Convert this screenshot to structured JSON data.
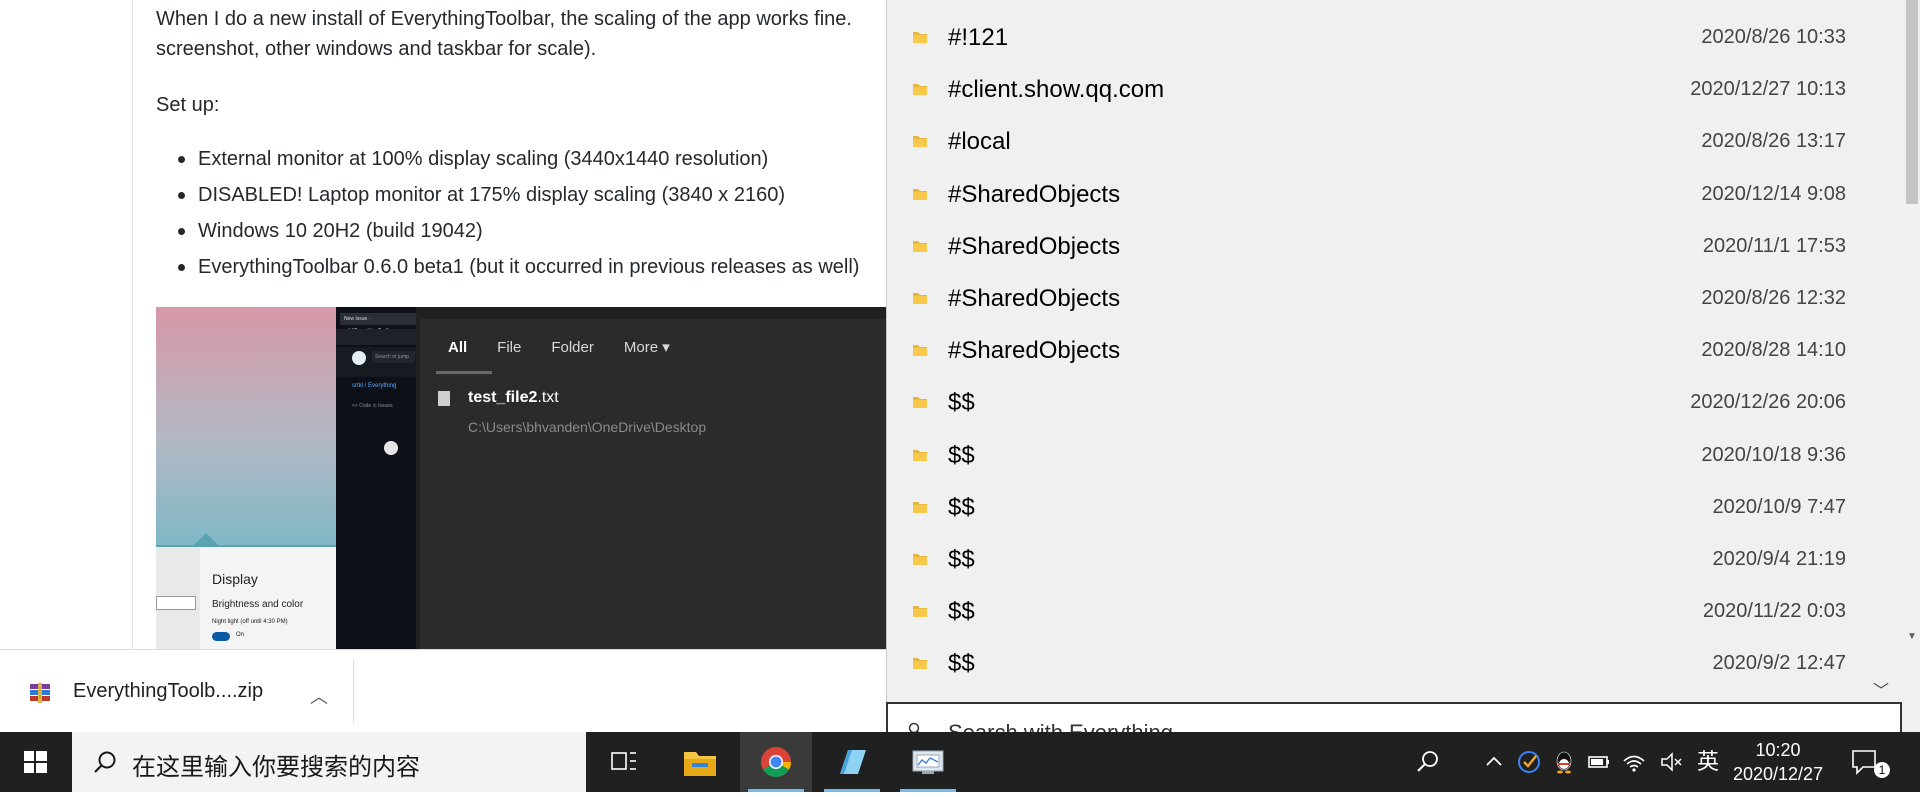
{
  "article": {
    "intro": "When I do a new install of EverythingToolbar, the scaling of the app works fine.",
    "intro_cont": "screenshot, other windows and taskbar for scale).",
    "setup_label": "Set up:",
    "bullets": [
      "External monitor at 100% display scaling (3440x1440 resolution)",
      "DISABLED! Laptop monitor at 175% display scaling (3840 x 2160)",
      "Windows 10 20H2 (build 19042)",
      "EverythingToolbar 0.6.0 beta1 (but it occurred in previous releases as well)"
    ]
  },
  "embedded_screenshot": {
    "settings_title": "Display",
    "settings_subtitle": "Brightness and color",
    "night_light": "Night light (off until 4:30 PM)",
    "toggle_label": "On",
    "browser_tab": "New Issue · srtkl/EverythingToolbar",
    "browser_search": "Search or jump",
    "browser_crumb": "srtkl / Everything",
    "browser_tabs": "<> Code   ⊙ Issues",
    "tabs": [
      "All",
      "File",
      "Folder",
      "More"
    ],
    "result_name_bold": "test_file2",
    "result_name_ext": ".txt",
    "result_path": "C:\\Users\\bhvanden\\OneDrive\\Desktop"
  },
  "download": {
    "filename": "EverythingToolb....zip"
  },
  "results": [
    {
      "name": "#!121",
      "date": "2020/8/26 10:33"
    },
    {
      "name": "#client.show.qq.com",
      "date": "2020/12/27 10:13"
    },
    {
      "name": "#local",
      "date": "2020/8/26 13:17"
    },
    {
      "name": "#SharedObjects",
      "date": "2020/12/14 9:08"
    },
    {
      "name": "#SharedObjects",
      "date": "2020/11/1 17:53"
    },
    {
      "name": "#SharedObjects",
      "date": "2020/8/26 12:32"
    },
    {
      "name": "#SharedObjects",
      "date": "2020/8/28 14:10"
    },
    {
      "name": "$$",
      "date": "2020/12/26 20:06"
    },
    {
      "name": "$$",
      "date": "2020/10/18 9:36"
    },
    {
      "name": "$$",
      "date": "2020/10/9 7:47"
    },
    {
      "name": "$$",
      "date": "2020/9/4 21:19"
    },
    {
      "name": "$$",
      "date": "2020/11/22 0:03"
    },
    {
      "name": "$$",
      "date": "2020/9/2 12:47"
    }
  ],
  "search": {
    "placeholder": "Search with Everything"
  },
  "taskbar": {
    "search_placeholder": "在这里输入你要搜索的内容",
    "ime": "英",
    "time": "10:20",
    "date": "2020/12/27",
    "notification_count": "1"
  },
  "colors": {
    "folder": "#f8c84a",
    "taskbar": "#202020",
    "panel": "#f0f0f0",
    "accent": "#76b9ed"
  },
  "icons": [
    "windows-start-icon",
    "search-icon",
    "task-view-icon",
    "file-explorer-icon",
    "chrome-icon",
    "notepad-icon",
    "app-icon",
    "folder-icon",
    "chevron-up-icon",
    "chevron-down-icon",
    "notification-icon",
    "wifi-icon",
    "volume-icon",
    "battery-icon",
    "qq-icon",
    "checkmark-icon"
  ]
}
